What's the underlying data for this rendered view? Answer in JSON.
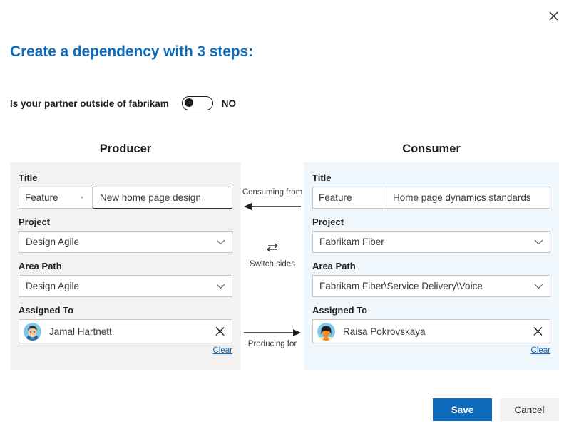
{
  "dialog": {
    "title": "Create a dependency with 3 steps:",
    "close_icon": "close-icon"
  },
  "partner": {
    "label": "Is your partner outside of fabrikam",
    "organization": "fabrikam",
    "toggle_state": "NO",
    "toggle_on": false
  },
  "columns": {
    "producer": {
      "heading": "Producer",
      "background": "#f3f2f1",
      "title_label": "Title",
      "work_item_type": "Feature",
      "title_value": "New home page design",
      "project_label": "Project",
      "project_value": "Design Agile",
      "area_path_label": "Area Path",
      "area_path_value": "Design Agile",
      "assigned_to_label": "Assigned To",
      "assigned_to_value": "Jamal Hartnett",
      "clear_label": "Clear"
    },
    "consumer": {
      "heading": "Consumer",
      "background": "#eff6fc",
      "title_label": "Title",
      "work_item_type": "Feature",
      "title_value": "Home page dynamics standards",
      "project_label": "Project",
      "project_value": "Fabrikam Fiber",
      "area_path_label": "Area Path",
      "area_path_value": "Fabrikam Fiber\\Service Delivery\\Voice",
      "assigned_to_label": "Assigned To",
      "assigned_to_value": "Raisa Pokrovskaya",
      "clear_label": "Clear"
    }
  },
  "middle": {
    "consuming_label": "Consuming from",
    "switch_label": "Switch sides",
    "producing_label": "Producing for"
  },
  "footer": {
    "save_label": "Save",
    "cancel_label": "Cancel"
  },
  "colors": {
    "accent": "#0f6cbd",
    "producer_panel": "#f3f2f1",
    "consumer_panel": "#eff6fc",
    "text": "#201f1e"
  }
}
